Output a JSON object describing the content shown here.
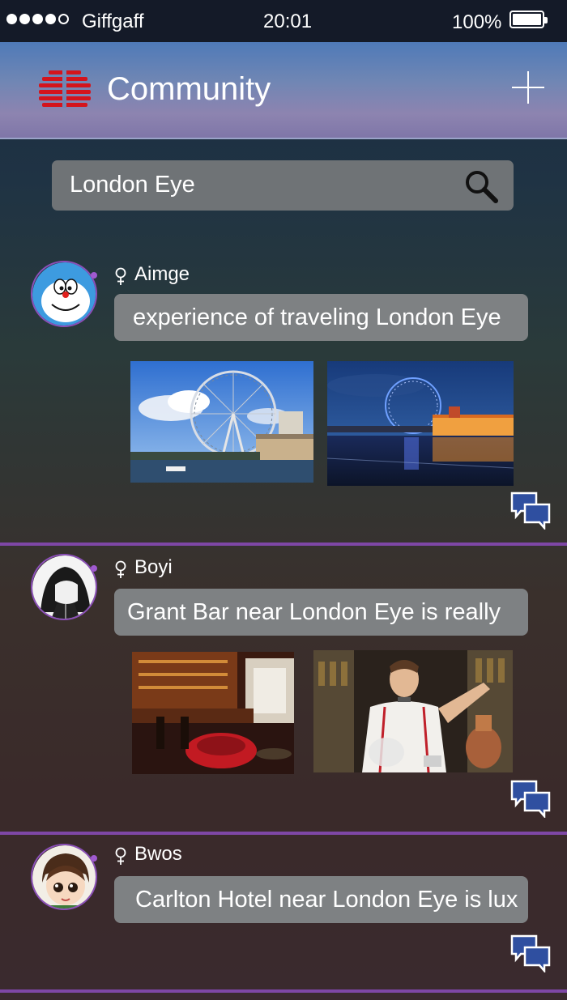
{
  "status_bar": {
    "carrier": "Giffgaff",
    "time": "20:01",
    "battery": "100%",
    "signal_bars_filled": 4,
    "signal_bars_total": 5
  },
  "header": {
    "title": "Community"
  },
  "search": {
    "value": "London Eye"
  },
  "posts": [
    {
      "username": "Aimge",
      "text": "experience of traveling London Eye",
      "photos": [
        "london-eye-daytime-photo",
        "london-eye-night-photo"
      ]
    },
    {
      "username": "Boyi",
      "text": "Grant Bar near London Eye is really",
      "photos": [
        "bar-interior-photo",
        "bartender-photo"
      ]
    },
    {
      "username": "Bwos",
      "text": "Carlton Hotel near London Eye is lux",
      "photos": []
    }
  ],
  "colors": {
    "accent_purple": "#7e47a6",
    "logo_red": "#d4141c",
    "comment_icon_blue": "#2f4fa0"
  }
}
